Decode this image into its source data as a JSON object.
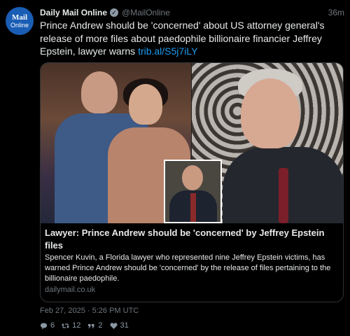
{
  "account": {
    "avatar_line1": "Mail",
    "avatar_line2": "Online",
    "name": "Daily Mail Online",
    "handle": "@MailOnline",
    "time_ago": "36m"
  },
  "tweet": {
    "text": "Prince Andrew should be 'concerned' about US attorney general's release of more files about paedophile billionaire financier Jeffrey Epstein, lawyer warns",
    "link": "trib.al/S5j7iLY"
  },
  "card": {
    "title": "Lawyer: Prince Andrew should be 'concerned' by Jeffrey Epstein files",
    "description": "Spencer Kuvin, a Florida lawyer who represented nine Jeffrey Epstein victims, has warned Prince Andrew should be 'concerned' by the release of files pertaining to the billionaire paedophile.",
    "domain": "dailymail.co.uk"
  },
  "timestamp": "Feb 27, 2025 · 5:26 PM UTC",
  "actions": {
    "replies": {
      "icon": "reply-icon",
      "value": "6"
    },
    "retweets": {
      "icon": "retweet-icon",
      "value": "12"
    },
    "quotes": {
      "icon": "quote-icon",
      "value": "2"
    },
    "likes": {
      "icon": "heart-icon",
      "value": "31"
    }
  },
  "colors": {
    "background": "#000000",
    "link": "#1d9bf0",
    "muted": "#6e767d",
    "avatar": "#1a5db5"
  }
}
